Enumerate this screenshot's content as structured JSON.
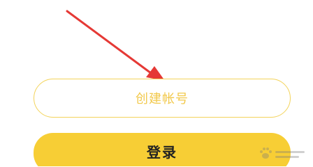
{
  "buttons": {
    "create_account_label": "创建帐号",
    "login_label": "登录"
  },
  "colors": {
    "accent_yellow": "#f7ce35",
    "outline_yellow": "#f3d35a",
    "outline_text": "#f2c94c",
    "login_text": "#222222",
    "annotation_arrow": "#e53935"
  },
  "icons": {
    "annotation": "arrow-pointer-icon",
    "watermark": "baidu-paw-watermark-icon"
  }
}
